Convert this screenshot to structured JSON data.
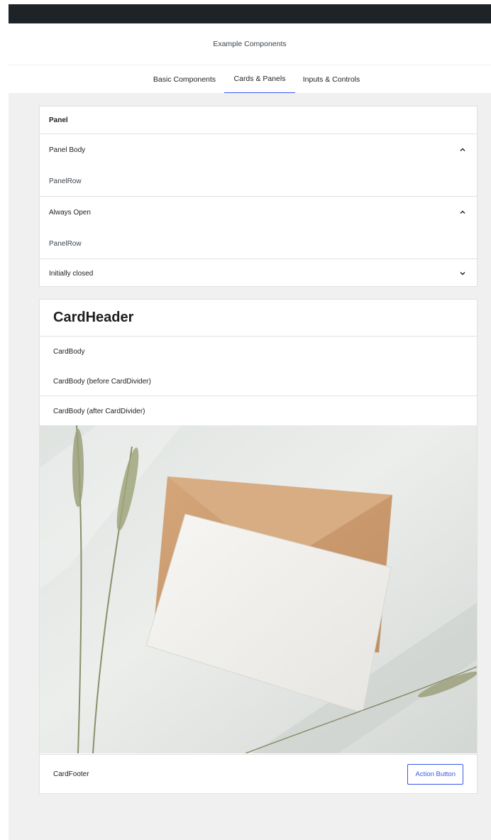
{
  "header": {
    "title": "Example Components"
  },
  "tabs": [
    {
      "label": "Basic Components"
    },
    {
      "label": "Cards & Panels"
    },
    {
      "label": "Inputs & Controls"
    }
  ],
  "panel": {
    "header": "Panel",
    "bodies": [
      {
        "title": "Panel Body",
        "row": "PanelRow",
        "state": "open"
      },
      {
        "title": "Always Open",
        "row": "PanelRow",
        "state": "open"
      },
      {
        "title": "Initially closed",
        "state": "closed"
      }
    ]
  },
  "card": {
    "header": "CardHeader",
    "body1": "CardBody",
    "body2": "CardBody (before CardDivider)",
    "body3": "CardBody (after CardDivider)",
    "media": {
      "subject": "envelope-with-blank-card-and-dried-wheat"
    },
    "footer": "CardFooter",
    "action_label": "Action Button"
  },
  "colors": {
    "accent": "#3858e9",
    "topbar": "#1d2327",
    "canvas": "#f0f0f1",
    "border": "#e0e0e0"
  }
}
